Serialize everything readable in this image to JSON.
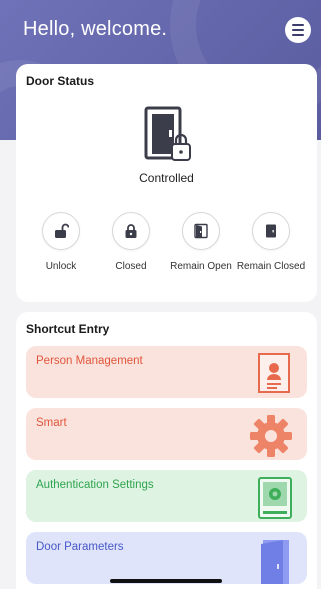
{
  "header": {
    "greeting": "Hello, welcome."
  },
  "door_status": {
    "title": "Door Status",
    "state": "Controlled",
    "actions": [
      {
        "label": "Unlock",
        "icon": "unlock-icon"
      },
      {
        "label": "Closed",
        "icon": "lock-icon"
      },
      {
        "label": "Remain Open",
        "icon": "door-open-icon"
      },
      {
        "label": "Remain Closed",
        "icon": "door-closed-icon"
      }
    ]
  },
  "shortcut": {
    "title": "Shortcut Entry",
    "items": [
      {
        "label": "Person Management",
        "bg": "#fbe3dd",
        "color": "#e0563c"
      },
      {
        "label": "Smart",
        "bg": "#fbe3dd",
        "color": "#e0563c"
      },
      {
        "label": "Authentication Settings",
        "bg": "#dff3e3",
        "color": "#2fa44f"
      },
      {
        "label": "Door Parameters",
        "bg": "#dfe4fa",
        "color": "#4758c8"
      }
    ]
  },
  "colors": {
    "header": "#6f72b8",
    "accent_dark": "#3c3d4a"
  }
}
